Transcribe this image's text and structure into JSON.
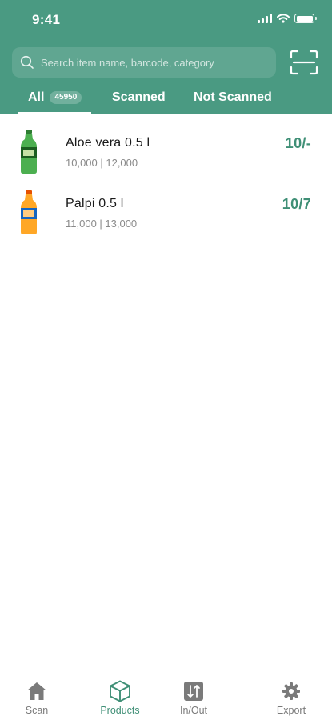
{
  "status_bar": {
    "time": "9:41"
  },
  "search": {
    "placeholder": "Search item name, barcode, category"
  },
  "tabs": [
    {
      "label": "All",
      "count": "45950",
      "active": true
    },
    {
      "label": "Scanned"
    },
    {
      "label": "Not Scanned"
    }
  ],
  "items": [
    {
      "name": "Aloe vera 0.5 l",
      "prices": "10,000 | 12,000",
      "count": "10/-",
      "image": "green-bottle"
    },
    {
      "name": "Palpi 0.5 l",
      "prices": "11,000 | 13,000",
      "count": "10/7",
      "image": "orange-bottle"
    }
  ],
  "bottom_nav": [
    {
      "label": "Scan",
      "icon": "home-icon"
    },
    {
      "label": "Products",
      "icon": "box-icon",
      "active": true
    },
    {
      "label": "In/Out",
      "icon": "in-out-icon"
    },
    {
      "label": "Export",
      "icon": "gear-icon"
    }
  ],
  "colors": {
    "primary": "#4a9a82",
    "accent": "#3f8f76"
  }
}
